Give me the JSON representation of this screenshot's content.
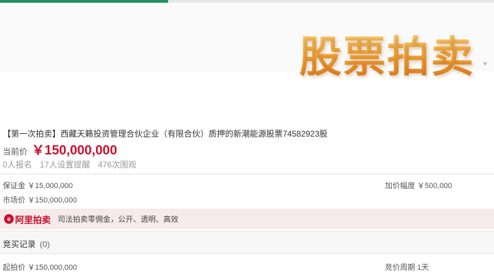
{
  "progress": 0.34,
  "banner": {
    "title": "股票拍卖",
    "watermark": "♥"
  },
  "item": {
    "title": "【第一次拍卖】西藏天籁投资管理合伙企业（有限合伙）质押的新潮能源股票74582923股",
    "price_label": "当前价",
    "price_value": "￥150,000,000",
    "stats": {
      "signups": "0人报名",
      "reminders": "17人设置提醒",
      "views": "476次围观"
    }
  },
  "info": {
    "deposit": "保证金 ￥15,000,000",
    "increment": "加价幅度 ￥500,000",
    "market_price": "市场价 ￥150,000,000"
  },
  "platform": {
    "logo_text": "阿里拍卖",
    "slogan": "司法拍卖零佣金，公开、透明、高效"
  },
  "records": {
    "title": "竞买记录",
    "count": "(0)"
  },
  "details": {
    "start_price": "起拍价 ￥150,000,000",
    "cycle": "竞价周期 1天"
  }
}
